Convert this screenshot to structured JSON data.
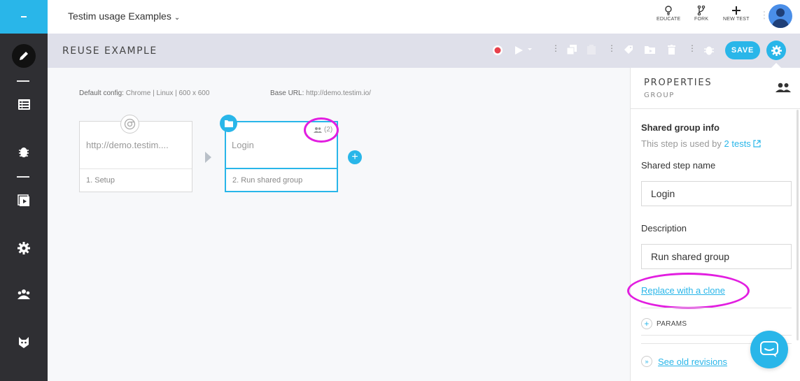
{
  "topbar": {
    "project_title": "Testim usage Examples",
    "actions": [
      {
        "label": "EDUCATE",
        "icon": "lightbulb-icon"
      },
      {
        "label": "FORK",
        "icon": "fork-icon"
      },
      {
        "label": "NEW TEST",
        "icon": "plus-icon"
      }
    ]
  },
  "toolbar": {
    "test_name": "REUSE EXAMPLE",
    "save_label": "SAVE",
    "icons": [
      "record-icon",
      "play-icon",
      "copy-icon",
      "paste-icon",
      "tag-icon",
      "folder-move-icon",
      "trash-icon",
      "bug-icon",
      "gear-icon"
    ]
  },
  "sidebar": {
    "items": [
      "edit-icon",
      "list-icon",
      "bug-icon",
      "video-icon",
      "settings-icon",
      "team-icon",
      "mask-icon"
    ]
  },
  "canvas": {
    "default_config_label": "Default config:",
    "default_config_value": "Chrome | Linux | 600 x 600",
    "base_url_label": "Base URL:",
    "base_url_value": "http://demo.testim.io/",
    "steps": [
      {
        "title": "http://demo.testim....",
        "footer": "1. Setup"
      },
      {
        "title": "Login",
        "footer": "2. Run shared group",
        "shared_count": "(2)"
      }
    ]
  },
  "properties": {
    "title": "PROPERTIES",
    "subtitle": "GROUP",
    "shared_info_header": "Shared group info",
    "used_by_prefix": "This step is used by",
    "used_by_link": "2 tests",
    "shared_name_label": "Shared step name",
    "shared_name_value": "Login",
    "description_label": "Description",
    "description_value": "Run shared group",
    "replace_link": "Replace with a clone",
    "params_label": "PARAMS",
    "revisions_link": "See old revisions"
  },
  "colors": {
    "accent": "#29b6e9",
    "sidebar": "#2f2f33",
    "highlight": "#e21ee0"
  }
}
